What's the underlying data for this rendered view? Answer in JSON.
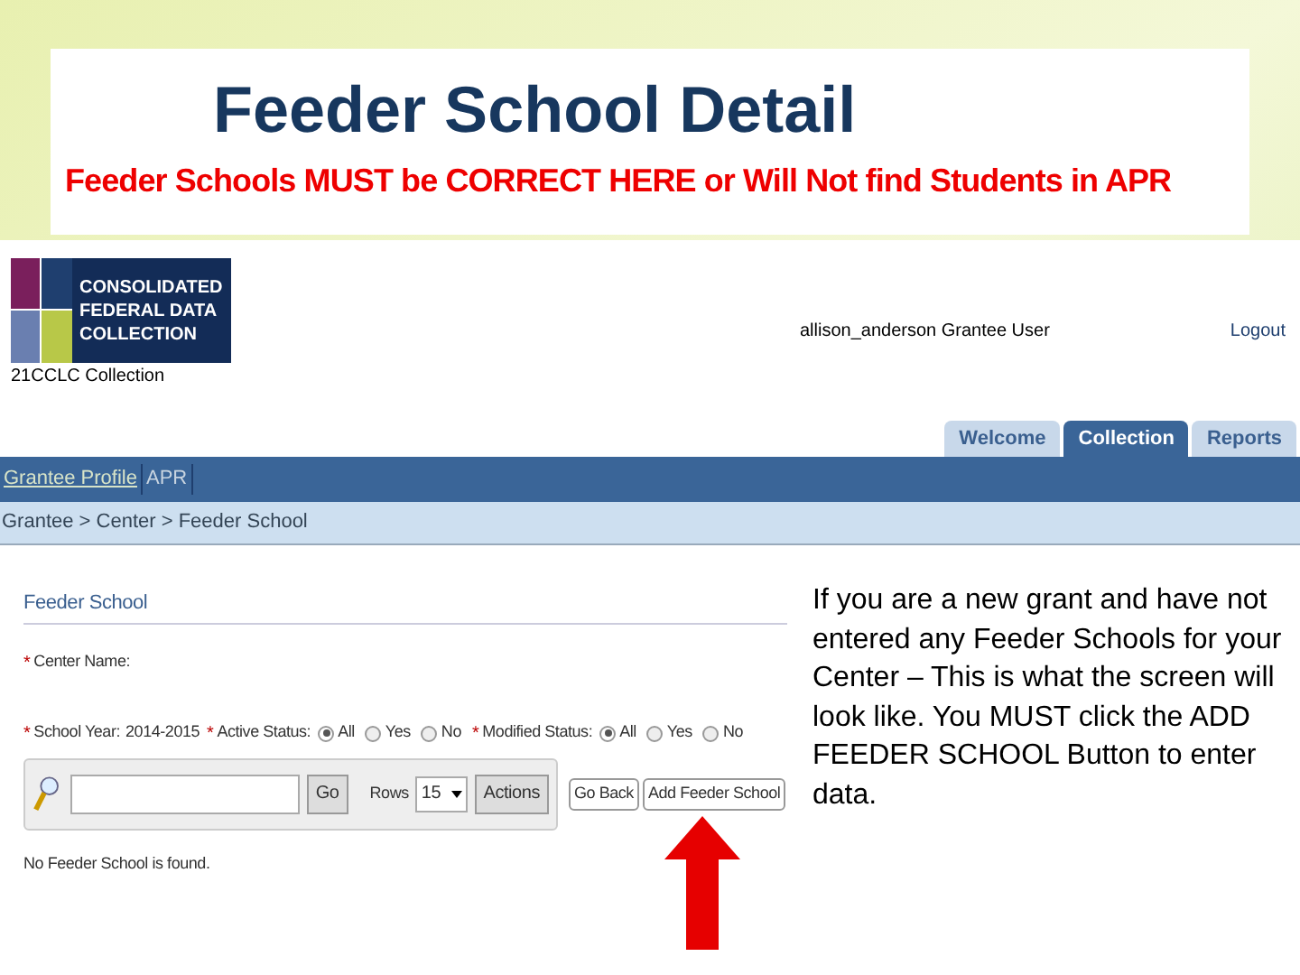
{
  "slide": {
    "title": "Feeder School Detail",
    "subtitle": "Feeder Schools MUST be CORRECT HERE or Will Not find Students in APR",
    "callout": "If you are a new grant and have not entered any Feeder Schools for your Center – This is what the screen will look like. You MUST click the ADD FEEDER SCHOOL Button to enter data."
  },
  "header": {
    "logo_lines": [
      "CONSOLIDATED",
      "FEDERAL DATA",
      "COLLECTION"
    ],
    "collection": "21CCLC Collection",
    "user": "allison_anderson Grantee User",
    "logout": "Logout"
  },
  "tabs": [
    {
      "label": "Welcome",
      "selected": false
    },
    {
      "label": "Collection",
      "selected": true
    },
    {
      "label": "Reports",
      "selected": false
    }
  ],
  "nav": [
    {
      "label": "Grantee Profile",
      "selected": true
    },
    {
      "label": "APR",
      "selected": false
    }
  ],
  "breadcrumb": "Grantee > Center > Feeder School",
  "form": {
    "title": "Feeder School",
    "required_mark": "*",
    "center_name_label": "Center Name:",
    "school_year_label": "School Year:",
    "school_year": "2014-2015",
    "active_status_label": "Active Status:",
    "active_status": [
      {
        "label": "All",
        "selected": true
      },
      {
        "label": "Yes",
        "selected": false
      },
      {
        "label": "No",
        "selected": false
      }
    ],
    "modified_status_label": "Modified Status:",
    "modified_status": [
      {
        "label": "All",
        "selected": true
      },
      {
        "label": "Yes",
        "selected": false
      },
      {
        "label": "No",
        "selected": false
      }
    ],
    "go": "Go",
    "rows_label": "Rows",
    "rows": "15",
    "actions": "Actions",
    "go_back": "Go Back",
    "add": "Add Feeder School",
    "message": "No Feeder School is found."
  }
}
